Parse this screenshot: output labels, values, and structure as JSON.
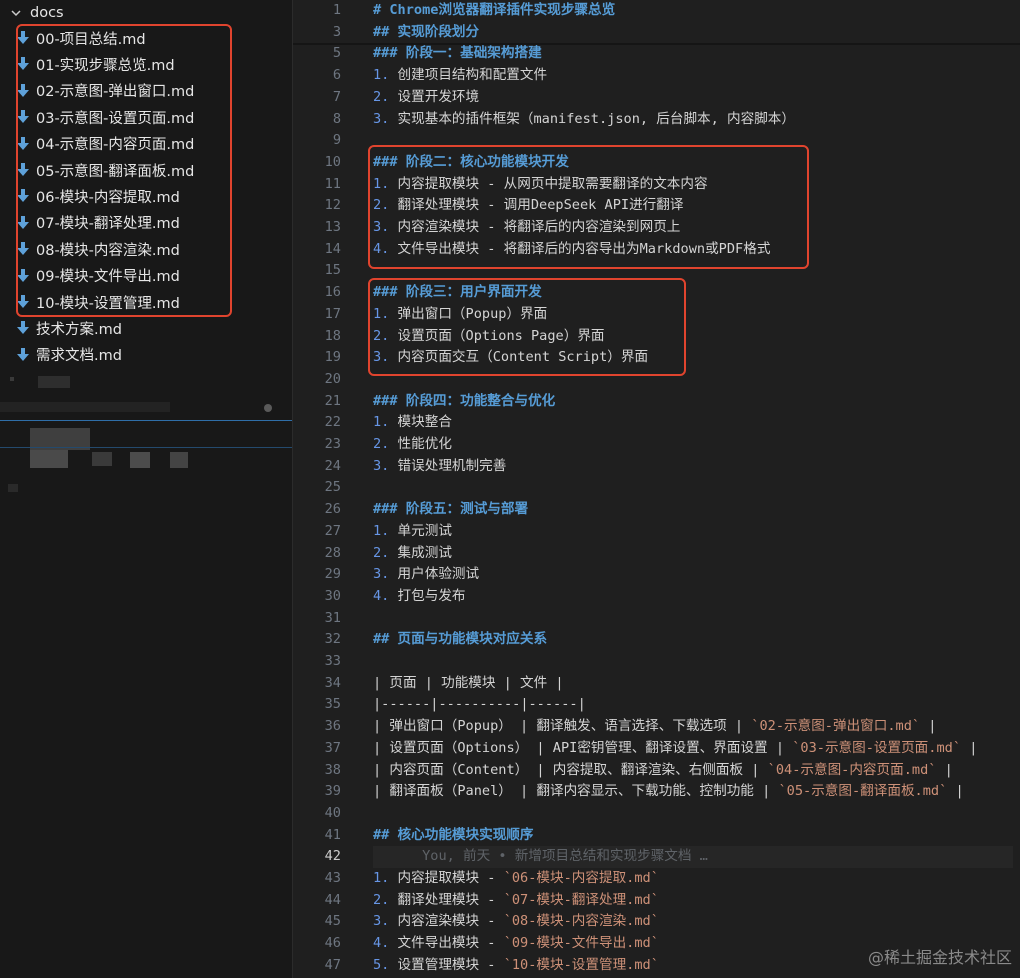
{
  "explorer": {
    "folder": "docs",
    "files": [
      "00-项目总结.md",
      "01-实现步骤总览.md",
      "02-示意图-弹出窗口.md",
      "03-示意图-设置页面.md",
      "04-示意图-内容页面.md",
      "05-示意图-翻译面板.md",
      "06-模块-内容提取.md",
      "07-模块-翻译处理.md",
      "08-模块-内容渲染.md",
      "09-模块-文件导出.md",
      "10-模块-设置管理.md",
      "技术方案.md",
      "需求文档.md"
    ],
    "file_icon": "markdown-download-icon",
    "highlight_color": "#e0442e"
  },
  "editor": {
    "lines": [
      {
        "n": "1",
        "parts": [
          {
            "t": "# Chrome浏览器翻译插件实现步骤总览",
            "c": "h"
          }
        ]
      },
      {
        "n": "3",
        "parts": [
          {
            "t": "## 实现阶段划分",
            "c": "h"
          }
        ]
      },
      {
        "n": "5",
        "parts": [
          {
            "t": "### 阶段一：基础架构搭建",
            "c": "h"
          }
        ]
      },
      {
        "n": "6",
        "parts": [
          {
            "t": "1.",
            "c": "num"
          },
          {
            "t": " 创建项目结构和配置文件",
            "c": ""
          }
        ]
      },
      {
        "n": "7",
        "parts": [
          {
            "t": "2.",
            "c": "num"
          },
          {
            "t": " 设置开发环境",
            "c": ""
          }
        ]
      },
      {
        "n": "8",
        "parts": [
          {
            "t": "3.",
            "c": "num"
          },
          {
            "t": " 实现基本的插件框架（manifest.json, 后台脚本, 内容脚本）",
            "c": ""
          }
        ]
      },
      {
        "n": "9",
        "parts": []
      },
      {
        "n": "10",
        "parts": [
          {
            "t": "### 阶段二：核心功能模块开发",
            "c": "h"
          }
        ]
      },
      {
        "n": "11",
        "parts": [
          {
            "t": "1.",
            "c": "num"
          },
          {
            "t": " 内容提取模块 - 从网页中提取需要翻译的文本内容",
            "c": ""
          }
        ]
      },
      {
        "n": "12",
        "parts": [
          {
            "t": "2.",
            "c": "num"
          },
          {
            "t": " 翻译处理模块 - 调用DeepSeek API进行翻译",
            "c": ""
          }
        ]
      },
      {
        "n": "13",
        "parts": [
          {
            "t": "3.",
            "c": "num"
          },
          {
            "t": " 内容渲染模块 - 将翻译后的内容渲染到网页上",
            "c": ""
          }
        ]
      },
      {
        "n": "14",
        "parts": [
          {
            "t": "4.",
            "c": "num"
          },
          {
            "t": " 文件导出模块 - 将翻译后的内容导出为Markdown或PDF格式",
            "c": ""
          }
        ]
      },
      {
        "n": "15",
        "parts": []
      },
      {
        "n": "16",
        "parts": [
          {
            "t": "### 阶段三：用户界面开发",
            "c": "h"
          }
        ]
      },
      {
        "n": "17",
        "parts": [
          {
            "t": "1.",
            "c": "num"
          },
          {
            "t": " 弹出窗口（Popup）界面",
            "c": ""
          }
        ]
      },
      {
        "n": "18",
        "parts": [
          {
            "t": "2.",
            "c": "num"
          },
          {
            "t": " 设置页面（Options Page）界面",
            "c": ""
          }
        ]
      },
      {
        "n": "19",
        "parts": [
          {
            "t": "3.",
            "c": "num"
          },
          {
            "t": " 内容页面交互（Content Script）界面",
            "c": ""
          }
        ]
      },
      {
        "n": "20",
        "parts": []
      },
      {
        "n": "21",
        "parts": [
          {
            "t": "### 阶段四：功能整合与优化",
            "c": "h"
          }
        ]
      },
      {
        "n": "22",
        "parts": [
          {
            "t": "1.",
            "c": "num"
          },
          {
            "t": " 模块整合",
            "c": ""
          }
        ]
      },
      {
        "n": "23",
        "parts": [
          {
            "t": "2.",
            "c": "num"
          },
          {
            "t": " 性能优化",
            "c": ""
          }
        ]
      },
      {
        "n": "24",
        "parts": [
          {
            "t": "3.",
            "c": "num"
          },
          {
            "t": " 错误处理机制完善",
            "c": ""
          }
        ]
      },
      {
        "n": "25",
        "parts": []
      },
      {
        "n": "26",
        "parts": [
          {
            "t": "### 阶段五：测试与部署",
            "c": "h"
          }
        ]
      },
      {
        "n": "27",
        "parts": [
          {
            "t": "1.",
            "c": "num"
          },
          {
            "t": " 单元测试",
            "c": ""
          }
        ]
      },
      {
        "n": "28",
        "parts": [
          {
            "t": "2.",
            "c": "num"
          },
          {
            "t": " 集成测试",
            "c": ""
          }
        ]
      },
      {
        "n": "29",
        "parts": [
          {
            "t": "3.",
            "c": "num"
          },
          {
            "t": " 用户体验测试",
            "c": ""
          }
        ]
      },
      {
        "n": "30",
        "parts": [
          {
            "t": "4.",
            "c": "num"
          },
          {
            "t": " 打包与发布",
            "c": ""
          }
        ]
      },
      {
        "n": "31",
        "parts": []
      },
      {
        "n": "32",
        "parts": [
          {
            "t": "## 页面与功能模块对应关系",
            "c": "h"
          }
        ]
      },
      {
        "n": "33",
        "parts": []
      },
      {
        "n": "34",
        "parts": [
          {
            "t": "| 页面 | 功能模块 | 文件 |",
            "c": ""
          }
        ]
      },
      {
        "n": "35",
        "parts": [
          {
            "t": "|------|----------|------|",
            "c": ""
          }
        ]
      },
      {
        "n": "36",
        "parts": [
          {
            "t": "| 弹出窗口（Popup） | 翻译触发、语言选择、下载选项 | ",
            "c": ""
          },
          {
            "t": "`02-示意图-弹出窗口.md`",
            "c": "cd"
          },
          {
            "t": " |",
            "c": ""
          }
        ]
      },
      {
        "n": "37",
        "parts": [
          {
            "t": "| 设置页面（Options） | API密钥管理、翻译设置、界面设置 | ",
            "c": ""
          },
          {
            "t": "`03-示意图-设置页面.md`",
            "c": "cd"
          },
          {
            "t": " |",
            "c": ""
          }
        ]
      },
      {
        "n": "38",
        "parts": [
          {
            "t": "| 内容页面（Content） | 内容提取、翻译渲染、右侧面板 | ",
            "c": ""
          },
          {
            "t": "`04-示意图-内容页面.md`",
            "c": "cd"
          },
          {
            "t": " |",
            "c": ""
          }
        ]
      },
      {
        "n": "39",
        "parts": [
          {
            "t": "| 翻译面板（Panel） | 翻译内容显示、下载功能、控制功能 | ",
            "c": ""
          },
          {
            "t": "`05-示意图-翻译面板.md`",
            "c": "cd"
          },
          {
            "t": " |",
            "c": ""
          }
        ]
      },
      {
        "n": "40",
        "parts": []
      },
      {
        "n": "41",
        "parts": [
          {
            "t": "## 核心功能模块实现顺序",
            "c": "h"
          }
        ]
      },
      {
        "n": "42",
        "parts": [
          {
            "t": "      You, 前天 • 新增项目总结和实现步骤文档 …",
            "c": "blame"
          }
        ],
        "active": true
      },
      {
        "n": "43",
        "parts": [
          {
            "t": "1.",
            "c": "num"
          },
          {
            "t": " 内容提取模块 - ",
            "c": ""
          },
          {
            "t": "`06-模块-内容提取.md`",
            "c": "cd"
          }
        ]
      },
      {
        "n": "44",
        "parts": [
          {
            "t": "2.",
            "c": "num"
          },
          {
            "t": " 翻译处理模块 - ",
            "c": ""
          },
          {
            "t": "`07-模块-翻译处理.md`",
            "c": "cd"
          }
        ]
      },
      {
        "n": "45",
        "parts": [
          {
            "t": "3.",
            "c": "num"
          },
          {
            "t": " 内容渲染模块 - ",
            "c": ""
          },
          {
            "t": "`08-模块-内容渲染.md`",
            "c": "cd"
          }
        ]
      },
      {
        "n": "46",
        "parts": [
          {
            "t": "4.",
            "c": "num"
          },
          {
            "t": " 文件导出模块 - ",
            "c": ""
          },
          {
            "t": "`09-模块-文件导出.md`",
            "c": "cd"
          }
        ]
      },
      {
        "n": "47",
        "parts": [
          {
            "t": "5.",
            "c": "num"
          },
          {
            "t": " 设置管理模块 - ",
            "c": ""
          },
          {
            "t": "`10-模块-设置管理.md`",
            "c": "cd"
          }
        ]
      }
    ],
    "highlight_color": "#e0442e"
  },
  "watermark": "@稀土掘金技术社区"
}
